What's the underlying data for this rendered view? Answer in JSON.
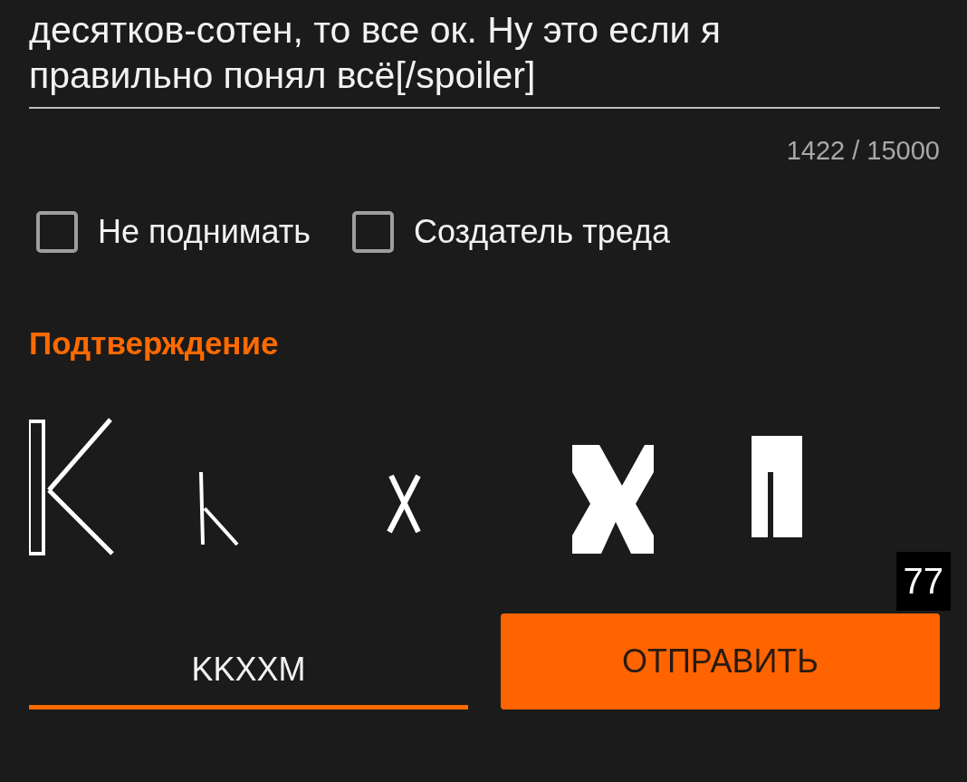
{
  "message": {
    "value": "десятков-сотен, то все ок. Ну это если я\nправильно понял всё[/spoiler]",
    "counter": "1422 / 15000"
  },
  "options": [
    {
      "label": "Не поднимать",
      "checked": false
    },
    {
      "label": "Создатель треда",
      "checked": false
    }
  ],
  "captcha": {
    "title": "Подтверждение",
    "timer": "77",
    "answer": "KKXXM"
  },
  "submit": {
    "label": "ОТПРАВИТЬ"
  }
}
